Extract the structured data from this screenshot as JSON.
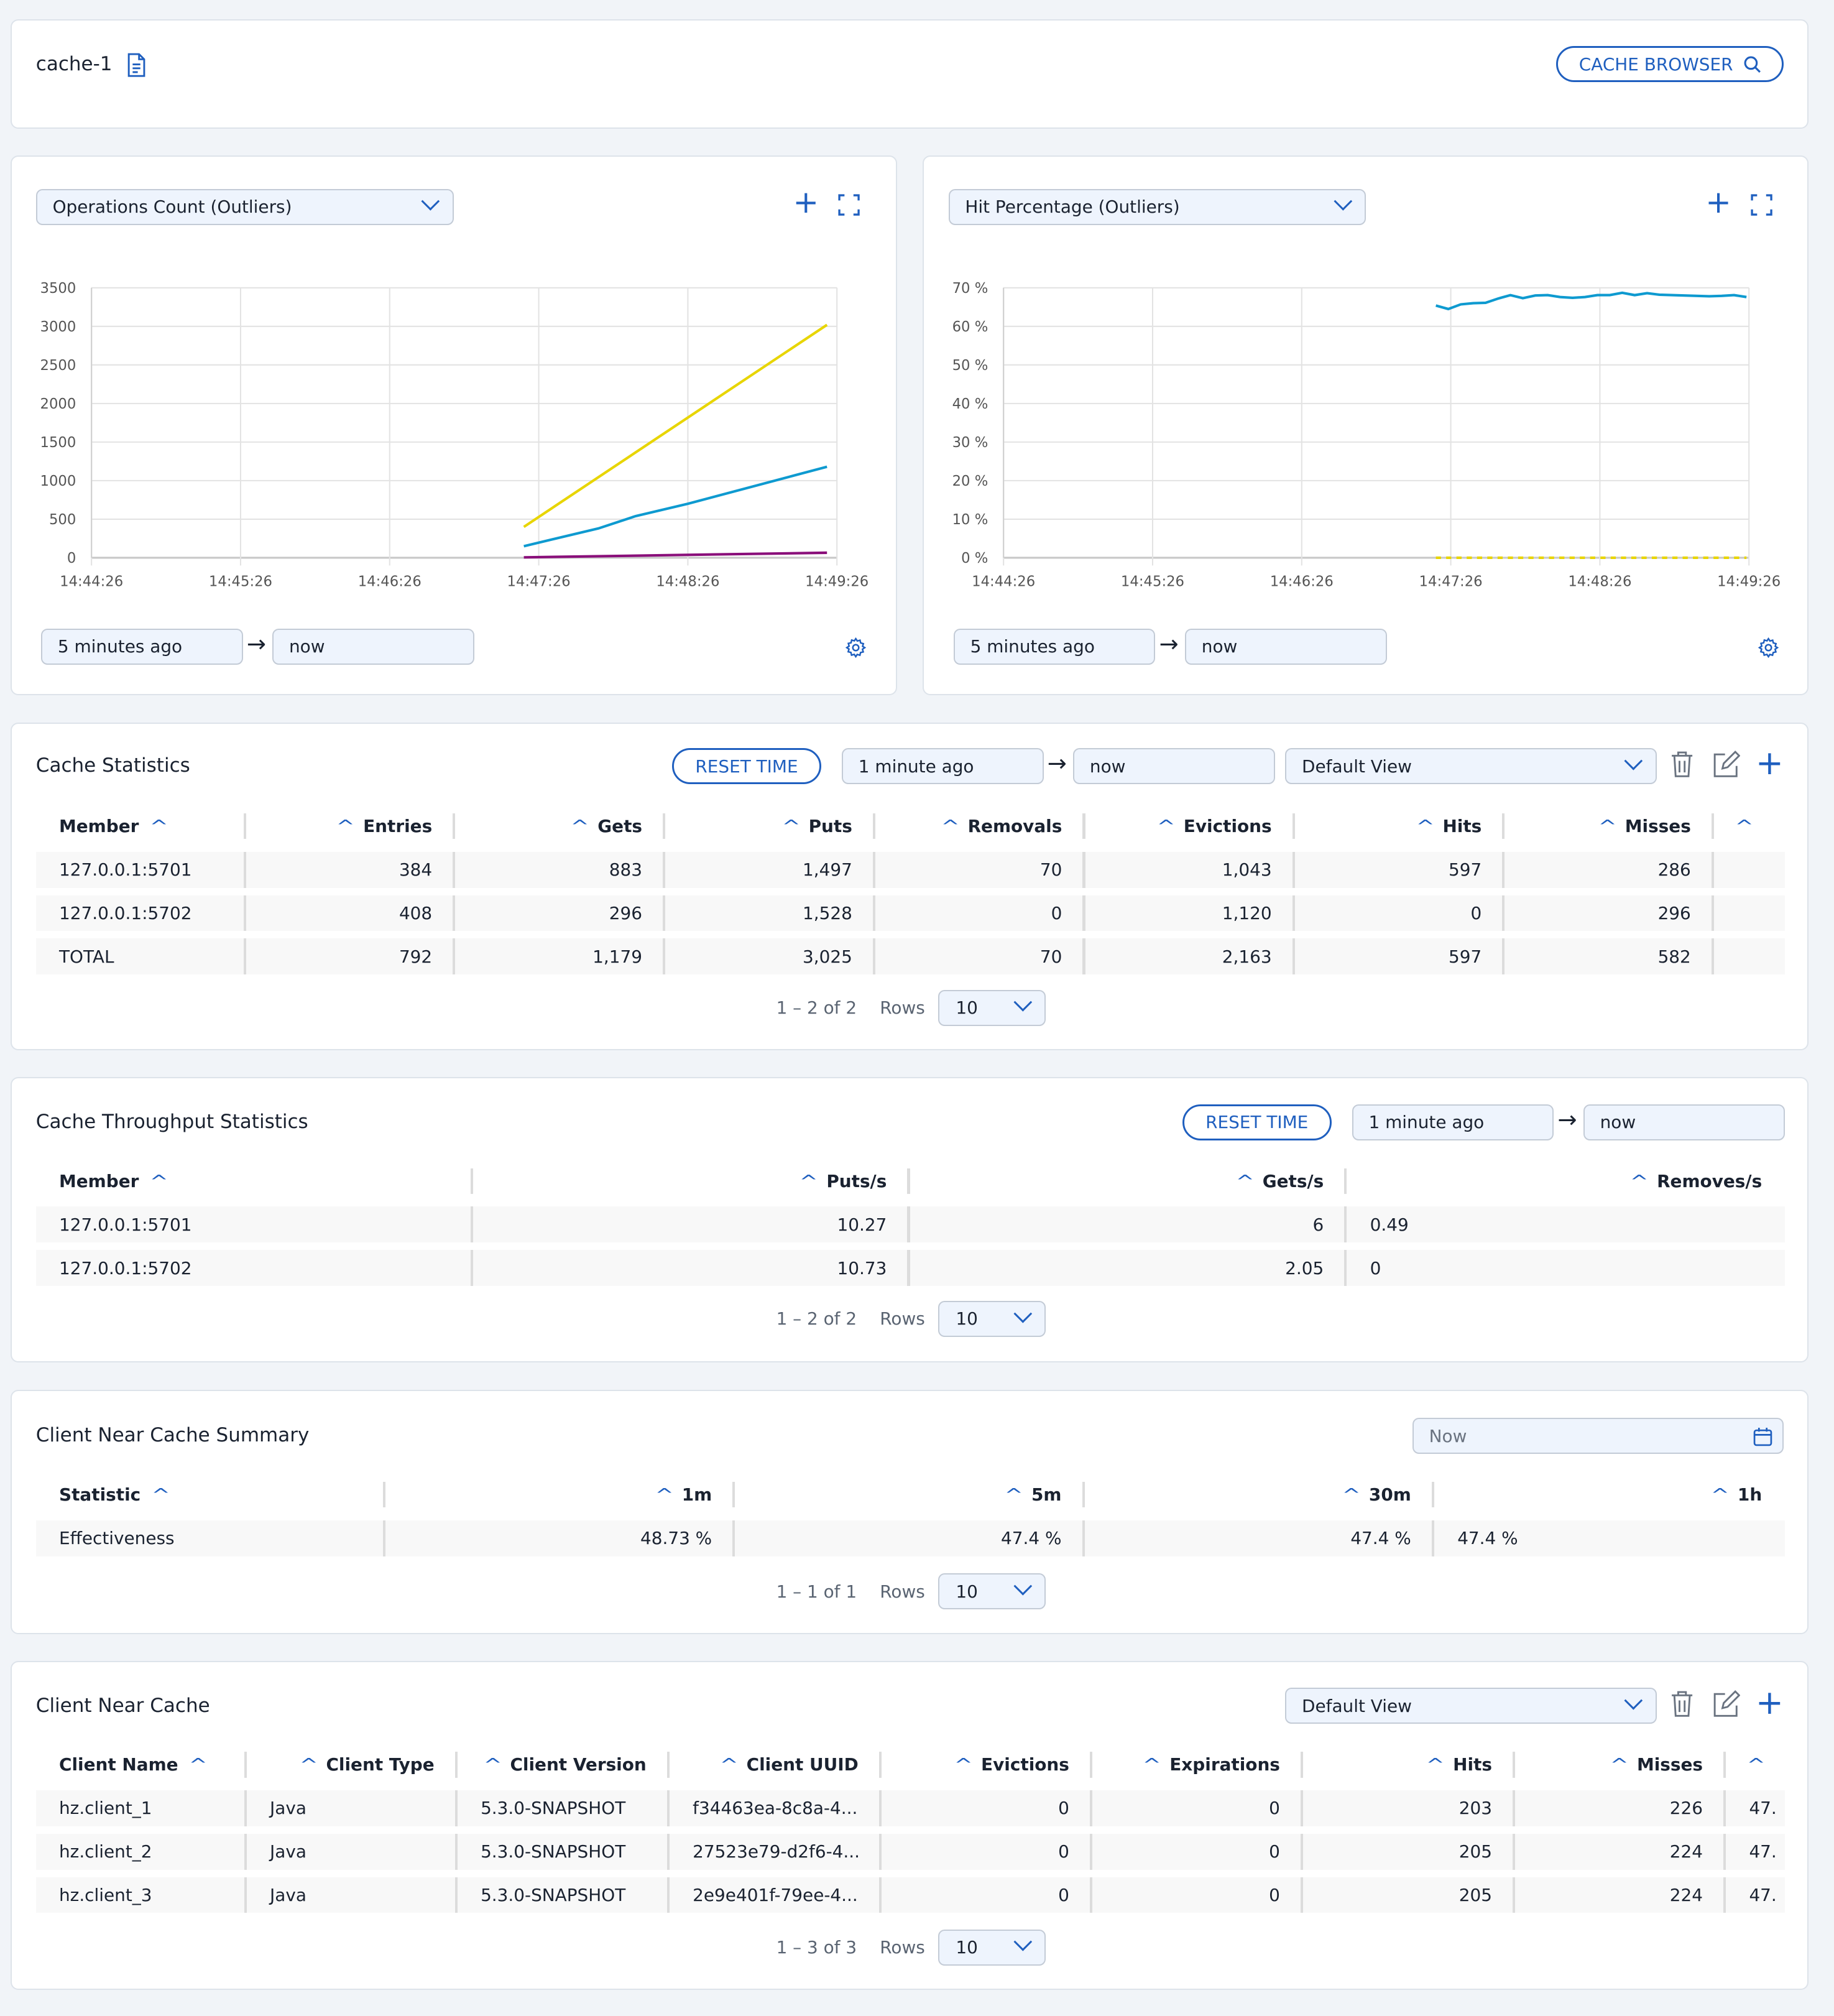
{
  "header": {
    "title": "cache-1",
    "doc_icon": "document-icon",
    "cache_browser_label": "CACHE BROWSER",
    "search_icon": "search-icon"
  },
  "charts": [
    {
      "selector": "Operations Count (Outliers)",
      "range_from": "5 minutes ago",
      "range_to": "now"
    },
    {
      "selector": "Hit Percentage (Outliers)",
      "range_from": "5 minutes ago",
      "range_to": "now"
    }
  ],
  "chart_data": [
    {
      "type": "line",
      "title": "Operations Count (Outliers)",
      "ylim": [
        0,
        3500
      ],
      "yticks": [
        "0",
        "500",
        "1000",
        "1500",
        "2000",
        "2500",
        "3000",
        "3500"
      ],
      "ytick_values": [
        0,
        500,
        1000,
        1500,
        2000,
        2500,
        3000,
        3500
      ],
      "xlim": [
        "14:44:26",
        "14:49:26"
      ],
      "xticks": [
        "14:44:26",
        "14:45:26",
        "14:46:26",
        "14:47:26",
        "14:48:26",
        "14:49:26"
      ],
      "grid": true,
      "series": [
        {
          "color": "#e8d500",
          "points": [
            [
              "14:47:20",
              400
            ],
            [
              "14:49:22",
              3020
            ]
          ]
        },
        {
          "color": "#0e9ad0",
          "points": [
            [
              "14:47:20",
              150
            ],
            [
              "14:47:50",
              380
            ],
            [
              "14:48:05",
              540
            ],
            [
              "14:48:26",
              700
            ],
            [
              "14:49:22",
              1180
            ]
          ]
        },
        {
          "color": "#8a0f7a",
          "points": [
            [
              "14:47:20",
              5
            ],
            [
              "14:49:22",
              65
            ]
          ]
        }
      ]
    },
    {
      "type": "line",
      "title": "Hit Percentage (Outliers)",
      "ylim": [
        0,
        70
      ],
      "yticks": [
        "0 %",
        "10 %",
        "20 %",
        "30 %",
        "40 %",
        "50 %",
        "60 %",
        "70 %"
      ],
      "ytick_values": [
        0,
        10,
        20,
        30,
        40,
        50,
        60,
        70
      ],
      "xlim": [
        "14:44:26",
        "14:49:26"
      ],
      "xticks": [
        "14:44:26",
        "14:45:26",
        "14:46:26",
        "14:47:26",
        "14:48:26",
        "14:49:26"
      ],
      "grid": true,
      "series": [
        {
          "color": "#0e9ad0",
          "points": [
            [
              "14:47:20",
              65.4
            ],
            [
              "14:47:25",
              64.5
            ],
            [
              "14:47:30",
              65.7
            ],
            [
              "14:47:35",
              66
            ],
            [
              "14:47:40",
              66.1
            ],
            [
              "14:47:45",
              67.2
            ],
            [
              "14:47:50",
              68.1
            ],
            [
              "14:47:55",
              67.3
            ],
            [
              "14:48:00",
              68
            ],
            [
              "14:48:05",
              68.1
            ],
            [
              "14:48:10",
              67.6
            ],
            [
              "14:48:15",
              67.4
            ],
            [
              "14:48:20",
              67.6
            ],
            [
              "14:48:25",
              68.1
            ],
            [
              "14:48:30",
              68.1
            ],
            [
              "14:48:35",
              68.7
            ],
            [
              "14:48:40",
              68.1
            ],
            [
              "14:48:45",
              68.6
            ],
            [
              "14:48:50",
              68.2
            ],
            [
              "14:48:55",
              68.1
            ],
            [
              "14:49:00",
              68
            ],
            [
              "14:49:05",
              67.9
            ],
            [
              "14:49:10",
              67.8
            ],
            [
              "14:49:15",
              67.9
            ],
            [
              "14:49:20",
              68.1
            ],
            [
              "14:49:25",
              67.6
            ]
          ]
        },
        {
          "color": "#e8d500",
          "dashed": true,
          "points": [
            [
              "14:47:20",
              0
            ],
            [
              "14:49:25",
              0
            ]
          ]
        }
      ]
    }
  ],
  "cache_stats": {
    "title": "Cache Statistics",
    "reset_label": "RESET TIME",
    "from": "1 minute ago",
    "to": "now",
    "view": "Default View",
    "columns": [
      "Member",
      "Entries",
      "Gets",
      "Puts",
      "Removals",
      "Evictions",
      "Hits",
      "Misses",
      ""
    ],
    "rows": [
      [
        "127.0.0.1:5701",
        "384",
        "883",
        "1,497",
        "70",
        "1,043",
        "597",
        "286",
        ""
      ],
      [
        "127.0.0.1:5702",
        "408",
        "296",
        "1,528",
        "0",
        "1,120",
        "0",
        "296",
        ""
      ],
      [
        "TOTAL",
        "792",
        "1,179",
        "3,025",
        "70",
        "2,163",
        "597",
        "582",
        ""
      ]
    ],
    "pager": "1 – 2 of 2",
    "rows_label": "Rows",
    "rows_value": "10"
  },
  "throughput": {
    "title": "Cache Throughput Statistics",
    "reset_label": "RESET TIME",
    "from": "1 minute ago",
    "to": "now",
    "columns": [
      "Member",
      "Puts/s",
      "Gets/s",
      "Removes/s"
    ],
    "rows": [
      [
        "127.0.0.1:5701",
        "10.27",
        "6",
        "0.49"
      ],
      [
        "127.0.0.1:5702",
        "10.73",
        "2.05",
        "0"
      ]
    ],
    "pager": "1 – 2 of 2",
    "rows_label": "Rows",
    "rows_value": "10"
  },
  "near_summary": {
    "title": "Client Near Cache Summary",
    "date_placeholder": "Now",
    "columns": [
      "Statistic",
      "1m",
      "5m",
      "30m",
      "1h"
    ],
    "rows": [
      [
        "Effectiveness",
        "48.73 %",
        "47.4 %",
        "47.4 %",
        "47.4 %"
      ]
    ],
    "pager": "1 – 1 of 1",
    "rows_label": "Rows",
    "rows_value": "10"
  },
  "near_cache": {
    "title": "Client Near Cache",
    "view": "Default View",
    "columns": [
      "Client Name",
      "Client Type",
      "Client Version",
      "Client UUID",
      "Evictions",
      "Expirations",
      "Hits",
      "Misses",
      ""
    ],
    "rows": [
      [
        "hz.client_1",
        "Java",
        "5.3.0-SNAPSHOT",
        "f34463ea-8c8a-4...",
        "0",
        "0",
        "203",
        "226",
        "47."
      ],
      [
        "hz.client_2",
        "Java",
        "5.3.0-SNAPSHOT",
        "27523e79-d2f6-4...",
        "0",
        "0",
        "205",
        "224",
        "47."
      ],
      [
        "hz.client_3",
        "Java",
        "5.3.0-SNAPSHOT",
        "2e9e401f-79ee-4...",
        "0",
        "0",
        "205",
        "224",
        "47."
      ]
    ],
    "pager": "1 – 3 of 3",
    "rows_label": "Rows",
    "rows_value": "10"
  },
  "colors": {
    "accent": "#1f5fbf",
    "background": "#f1f4f8",
    "field": "#eef4fd"
  }
}
